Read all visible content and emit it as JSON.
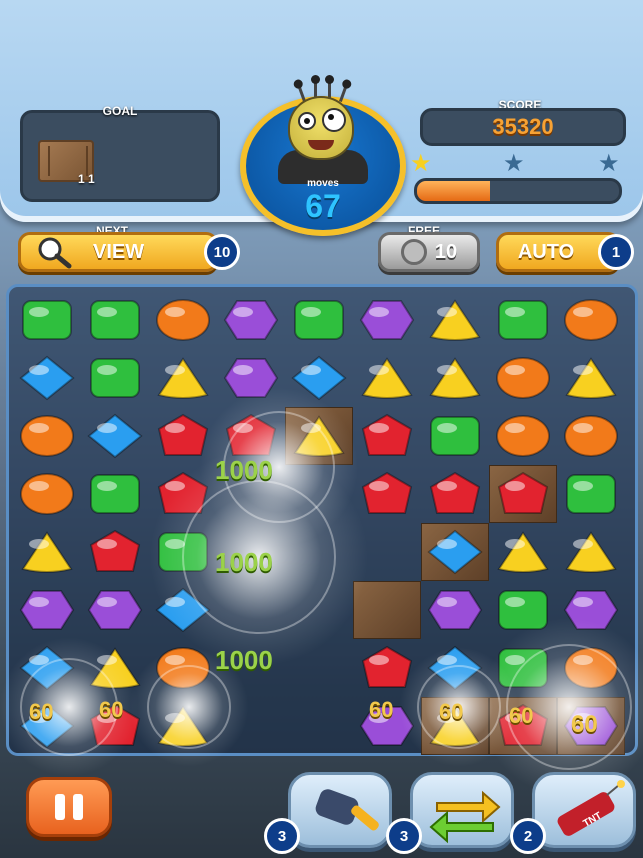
{
  "header": {
    "goal_label": "GOAL",
    "goal_count": "1 1",
    "score_label": "SCORE",
    "score_value": "35320",
    "moves_label": "moves",
    "moves_value": "67",
    "progress_fraction": 0.36,
    "stars": [
      {
        "name": "star-1",
        "earned": true
      },
      {
        "name": "star-2",
        "earned": false
      },
      {
        "name": "star-3",
        "earned": false
      }
    ]
  },
  "controls": {
    "next_label": "NEXT",
    "view_label": "VIEW",
    "view_badge": "10",
    "free_label": "FREE",
    "free_count": "10",
    "auto_label": "AUTO",
    "auto_badge": "1"
  },
  "board": {
    "popups": [
      "1000",
      "1000",
      "1000",
      "60",
      "60",
      "60",
      "60",
      "60",
      "60"
    ]
  },
  "boosters": [
    {
      "name": "hammer",
      "count": "3"
    },
    {
      "name": "swap",
      "count": "3"
    },
    {
      "name": "tnt",
      "count": "2"
    }
  ],
  "colors": {
    "green": "#2fbf3e",
    "blue": "#2a9ef0",
    "orange": "#f27a1a",
    "purple": "#9a4ed8",
    "yellow": "#f8d020",
    "red": "#e2232f"
  }
}
